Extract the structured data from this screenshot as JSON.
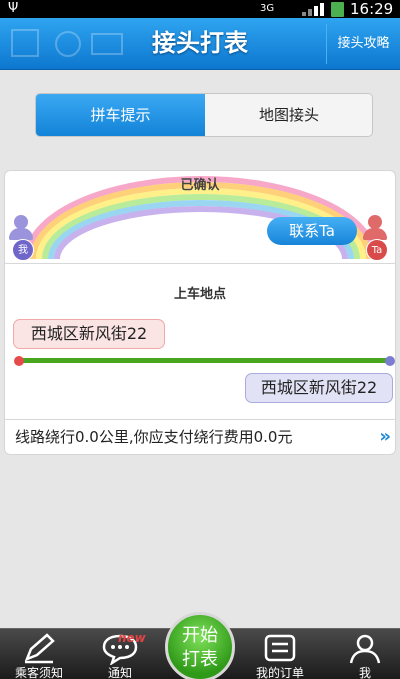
{
  "status_bar": {
    "network": "3G",
    "time": "16:29"
  },
  "header": {
    "title": "接头打表",
    "guide_label": "接头攻略"
  },
  "tabs": [
    {
      "label": "拼车提示",
      "selected": true
    },
    {
      "label": "地图接头",
      "selected": false
    }
  ],
  "card": {
    "status": "已确认",
    "me_badge": "我",
    "other_badge": "Ta",
    "contact_button": "联系Ta",
    "pickup_label": "上车地点",
    "from_place": "西城区新风街22",
    "to_place": "西城区新风街22",
    "detour_text": "线路绕行0.0公里,你应支付绕行费用0.0元",
    "more_icon": "»"
  },
  "bottom_nav": {
    "items": [
      {
        "label": "乘客须知",
        "icon": "pen-icon"
      },
      {
        "label": "通知",
        "icon": "chat-icon",
        "badge": "new"
      },
      {
        "label": "我的订单",
        "icon": "list-icon"
      },
      {
        "label": "我",
        "icon": "user-icon"
      }
    ],
    "start_line1": "开始",
    "start_line2": "打表"
  },
  "colors": {
    "accent": "#1a8be0",
    "route": "#4aa51f",
    "start_button": "#3fae22"
  }
}
